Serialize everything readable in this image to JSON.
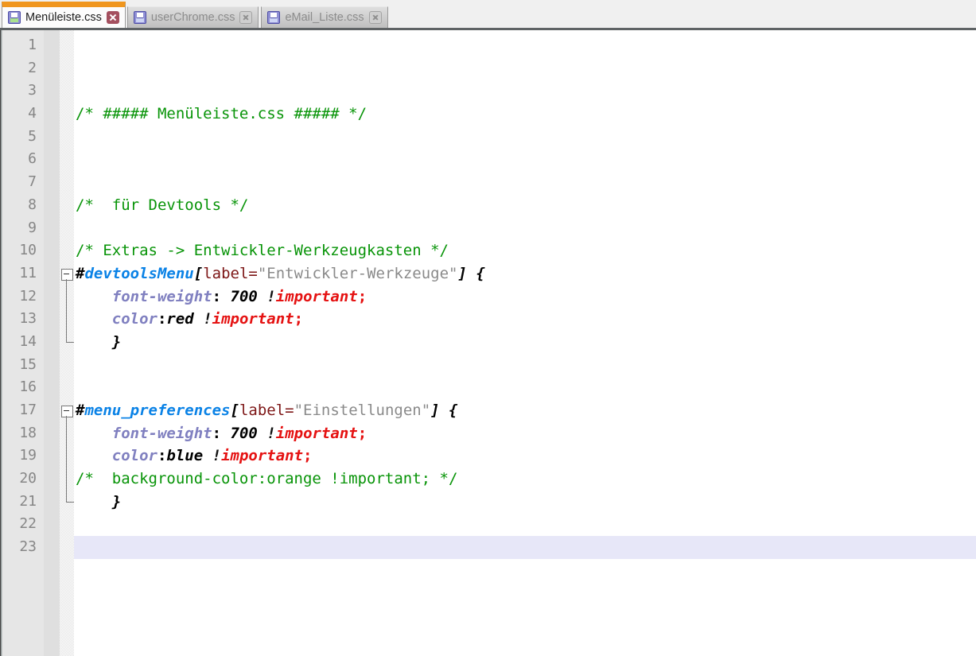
{
  "tabs": [
    {
      "label": "Menüleiste.css",
      "active": true,
      "icon": "floppy-disk-icon",
      "close_icon": "close-icon"
    },
    {
      "label": "userChrome.css",
      "active": false,
      "icon": "floppy-disk-icon",
      "close_icon": "close-icon"
    },
    {
      "label": "eMail_Liste.css",
      "active": false,
      "icon": "floppy-disk-icon",
      "close_icon": "close-icon"
    }
  ],
  "colors": {
    "active_tab_accent": "#f0961e",
    "current_line_highlight": "#e7e7f8",
    "comment_green": "#089408",
    "selector_blue": "#0a82e6",
    "attribute_maroon": "#7d1616",
    "string_gray": "#8a8a8a",
    "property_slate": "#8080c0",
    "important_red": "#e51212",
    "active_close_bg": "#a4505f"
  },
  "editor": {
    "language": "css",
    "lines": [
      {
        "num": 1,
        "fold": null,
        "current": false,
        "tokens": []
      },
      {
        "num": 2,
        "fold": null,
        "current": false,
        "tokens": []
      },
      {
        "num": 3,
        "fold": null,
        "current": false,
        "tokens": []
      },
      {
        "num": 4,
        "fold": null,
        "current": false,
        "tokens": [
          {
            "c": "comment",
            "t": "/* ##### Menüleiste.css ##### */"
          }
        ]
      },
      {
        "num": 5,
        "fold": null,
        "current": false,
        "tokens": []
      },
      {
        "num": 6,
        "fold": null,
        "current": false,
        "tokens": []
      },
      {
        "num": 7,
        "fold": null,
        "current": false,
        "tokens": []
      },
      {
        "num": 8,
        "fold": null,
        "current": false,
        "tokens": [
          {
            "c": "comment",
            "t": "/*  für Devtools */"
          }
        ]
      },
      {
        "num": 9,
        "fold": null,
        "current": false,
        "tokens": []
      },
      {
        "num": 10,
        "fold": null,
        "current": false,
        "tokens": [
          {
            "c": "comment",
            "t": "/* Extras -> Entwickler-Werkzeugkasten */"
          }
        ]
      },
      {
        "num": 11,
        "fold": "start",
        "current": false,
        "tokens": [
          {
            "c": "punct",
            "t": "#"
          },
          {
            "c": "id",
            "t": "devtoolsMenu"
          },
          {
            "c": "punct",
            "t": "["
          },
          {
            "c": "attr",
            "t": "label="
          },
          {
            "c": "str",
            "t": "\"Entwickler-Werkzeuge\""
          },
          {
            "c": "punct",
            "t": "] {"
          }
        ]
      },
      {
        "num": 12,
        "fold": "mid",
        "current": false,
        "tokens": [
          {
            "c": "plain",
            "t": "    "
          },
          {
            "c": "prop",
            "t": "font-weight"
          },
          {
            "c": "colon",
            "t": ":"
          },
          {
            "c": "plain",
            "t": " "
          },
          {
            "c": "val",
            "t": "700"
          },
          {
            "c": "plain",
            "t": " "
          },
          {
            "c": "bang",
            "t": "!"
          },
          {
            "c": "imp",
            "t": "important"
          },
          {
            "c": "semi",
            "t": ";"
          }
        ]
      },
      {
        "num": 13,
        "fold": "mid",
        "current": false,
        "tokens": [
          {
            "c": "plain",
            "t": "    "
          },
          {
            "c": "prop",
            "t": "color"
          },
          {
            "c": "colon",
            "t": ":"
          },
          {
            "c": "val",
            "t": "red"
          },
          {
            "c": "plain",
            "t": " "
          },
          {
            "c": "bang",
            "t": "!"
          },
          {
            "c": "imp",
            "t": "important"
          },
          {
            "c": "semi",
            "t": ";"
          }
        ]
      },
      {
        "num": 14,
        "fold": "end",
        "current": false,
        "tokens": [
          {
            "c": "plain",
            "t": "    "
          },
          {
            "c": "punct",
            "t": "}"
          }
        ]
      },
      {
        "num": 15,
        "fold": null,
        "current": false,
        "tokens": []
      },
      {
        "num": 16,
        "fold": null,
        "current": false,
        "tokens": []
      },
      {
        "num": 17,
        "fold": "start",
        "current": false,
        "tokens": [
          {
            "c": "punct",
            "t": "#"
          },
          {
            "c": "id",
            "t": "menu_preferences"
          },
          {
            "c": "punct",
            "t": "["
          },
          {
            "c": "attr",
            "t": "label="
          },
          {
            "c": "str",
            "t": "\"Einstellungen\""
          },
          {
            "c": "punct",
            "t": "] {"
          }
        ]
      },
      {
        "num": 18,
        "fold": "mid",
        "current": false,
        "tokens": [
          {
            "c": "plain",
            "t": "    "
          },
          {
            "c": "prop",
            "t": "font-weight"
          },
          {
            "c": "colon",
            "t": ":"
          },
          {
            "c": "plain",
            "t": " "
          },
          {
            "c": "val",
            "t": "700"
          },
          {
            "c": "plain",
            "t": " "
          },
          {
            "c": "bang",
            "t": "!"
          },
          {
            "c": "imp",
            "t": "important"
          },
          {
            "c": "semi",
            "t": ";"
          }
        ]
      },
      {
        "num": 19,
        "fold": "mid",
        "current": false,
        "tokens": [
          {
            "c": "plain",
            "t": "    "
          },
          {
            "c": "prop",
            "t": "color"
          },
          {
            "c": "colon",
            "t": ":"
          },
          {
            "c": "val",
            "t": "blue"
          },
          {
            "c": "plain",
            "t": " "
          },
          {
            "c": "bang",
            "t": "!"
          },
          {
            "c": "imp",
            "t": "important"
          },
          {
            "c": "semi",
            "t": ";"
          }
        ]
      },
      {
        "num": 20,
        "fold": "mid",
        "current": false,
        "tokens": [
          {
            "c": "comment",
            "t": "/*  background-color:orange !important; */"
          }
        ]
      },
      {
        "num": 21,
        "fold": "end",
        "current": false,
        "tokens": [
          {
            "c": "plain",
            "t": "    "
          },
          {
            "c": "punct",
            "t": "}"
          }
        ]
      },
      {
        "num": 22,
        "fold": null,
        "current": false,
        "tokens": []
      },
      {
        "num": 23,
        "fold": null,
        "current": true,
        "tokens": []
      }
    ]
  }
}
